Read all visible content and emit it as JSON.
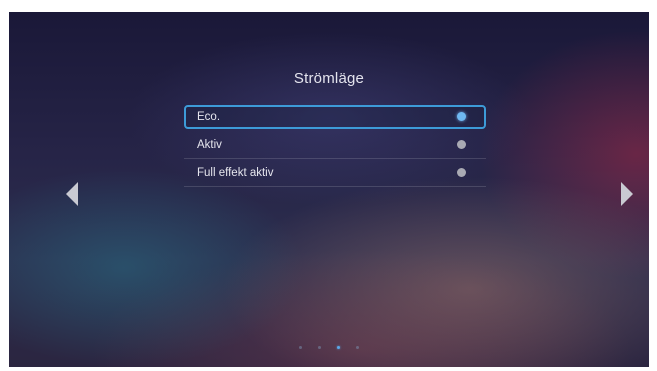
{
  "menu": {
    "title": "Strömläge",
    "items": [
      {
        "label": "Eco.",
        "selected": true
      },
      {
        "label": "Aktiv",
        "selected": false
      },
      {
        "label": "Full effekt aktiv",
        "selected": false
      }
    ]
  },
  "navigation": {
    "left_icon": "triangle-left",
    "right_icon": "triangle-right"
  },
  "pager": {
    "total_pages": 4,
    "current_page": 3
  },
  "colors": {
    "selection_border": "#3d9bd8",
    "selected_radio": "#6fb8f0",
    "unselected_radio": "#a9aab3",
    "text": "#e6e6ee"
  }
}
